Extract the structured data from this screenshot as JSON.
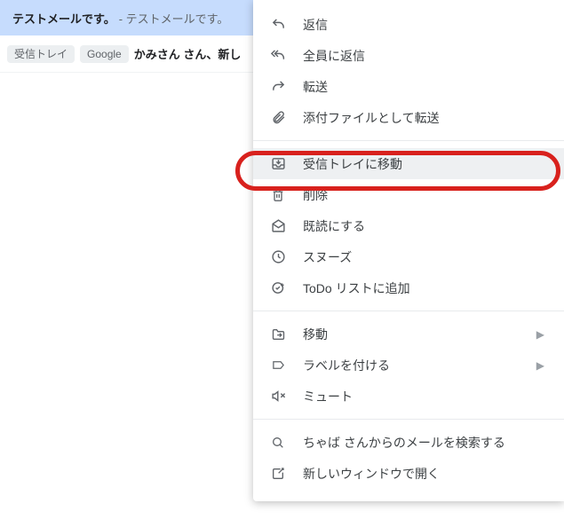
{
  "row1": {
    "subject": "テストメールです。",
    "snippet": " - テストメールです。"
  },
  "row2": {
    "chip1": "受信トレイ",
    "chip2": "Google",
    "title": "かみさん さん、新し"
  },
  "menu": {
    "reply": "返信",
    "reply_all": "全員に返信",
    "forward": "転送",
    "forward_attach": "添付ファイルとして転送",
    "move_inbox": "受信トレイに移動",
    "delete": "削除",
    "mark_read": "既読にする",
    "snooze": "スヌーズ",
    "add_todo": "ToDo リストに追加",
    "move": "移動",
    "label": "ラベルを付ける",
    "mute": "ミュート",
    "search_from": "ちゃば さんからのメールを検索する",
    "open_new": "新しいウィンドウで開く"
  }
}
